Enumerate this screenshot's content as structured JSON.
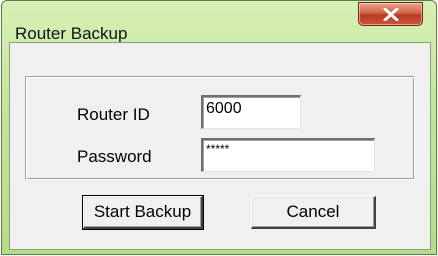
{
  "window": {
    "title": "Router Backup",
    "close_glyph": "x"
  },
  "form": {
    "router_id_label": "Router ID",
    "router_id_value": "6000",
    "password_label": "Password",
    "password_value": "*****"
  },
  "buttons": {
    "start_backup": "Start Backup",
    "cancel": "Cancel"
  },
  "colors": {
    "titlebar": "#c3e59a",
    "close_button": "#c9563a",
    "client_background": "#f0f0f0"
  }
}
